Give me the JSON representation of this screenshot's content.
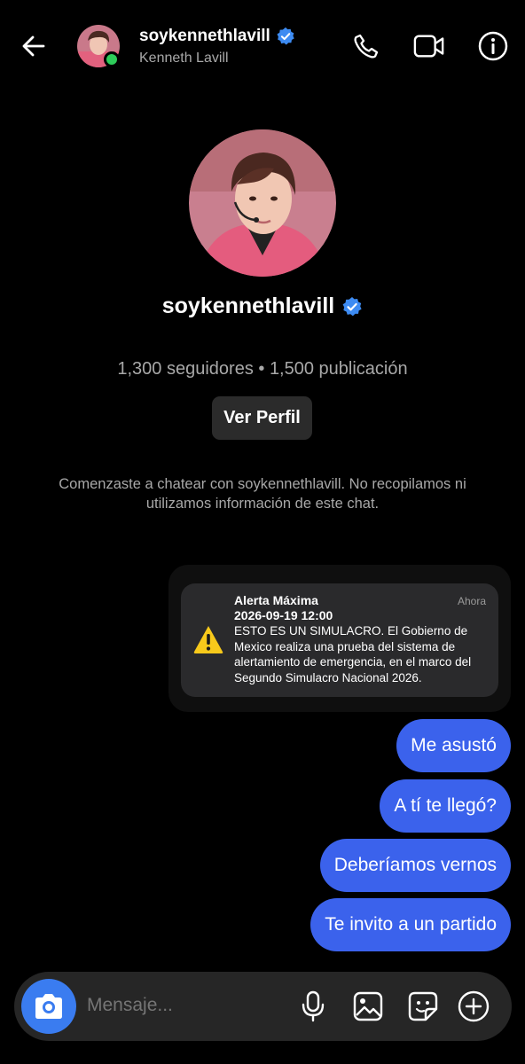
{
  "header": {
    "username": "soykennethlavill",
    "display_name": "Kenneth Lavill",
    "verified": true,
    "online": true,
    "online_color": "#2ecc5a"
  },
  "profile": {
    "username": "soykennethlavill",
    "stats": "1,300 seguidores • 1,500 publicación",
    "view_profile_label": "Ver Perfil",
    "intro": "Comenzaste a chatear con soykennethlavill. No recopilamos ni utilizamos información de este chat."
  },
  "alert": {
    "title": "Alerta Máxima",
    "time": "Ahora",
    "date": "2026-09-19 12:00",
    "body": "ESTO ES UN SIMULACRO. El Gobierno de Mexico realiza una prueba del sistema de alertamiento de emergencia, en el marco del Segundo Simulacro Nacional 2026.",
    "icon": "warning-icon"
  },
  "messages": [
    {
      "text": "Me asustó"
    },
    {
      "text": "A tí te llegó?"
    },
    {
      "text": "Deberíamos vernos"
    },
    {
      "text": "Te invito a un partido"
    }
  ],
  "composer": {
    "placeholder": "Mensaje..."
  },
  "colors": {
    "accent": "#3b62ec",
    "verified": "#3d8bf2",
    "camera": "#3a7cf0"
  },
  "icons": [
    "back-arrow-icon",
    "phone-icon",
    "video-camera-icon",
    "info-icon",
    "camera-icon",
    "microphone-icon",
    "gallery-icon",
    "sticker-icon",
    "plus-icon"
  ]
}
